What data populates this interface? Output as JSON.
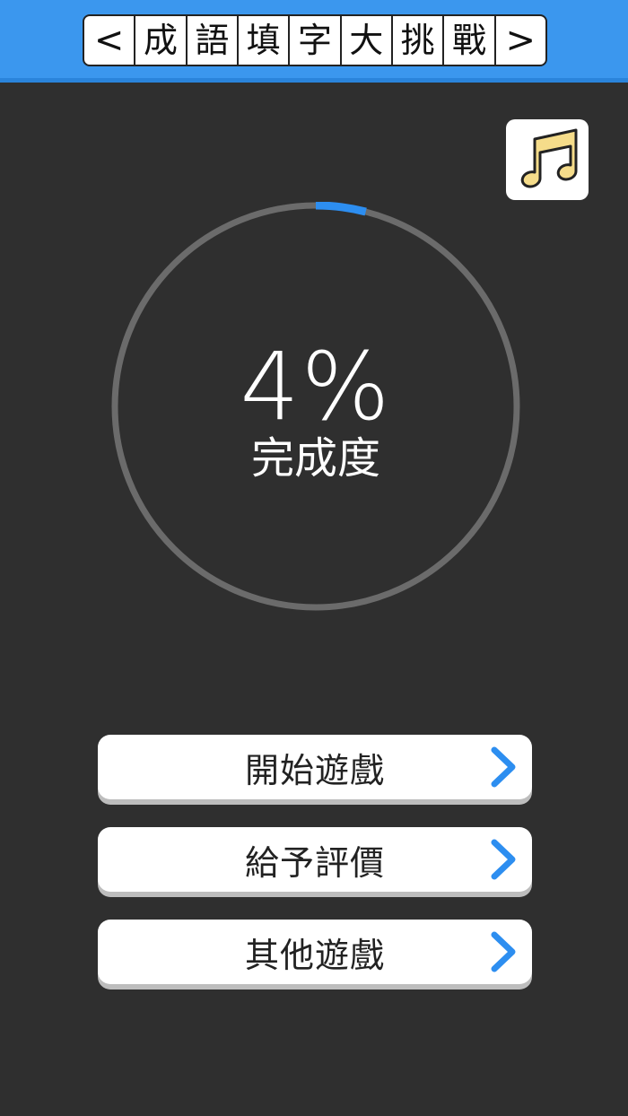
{
  "header": {
    "title_cells": [
      "<",
      "成",
      "語",
      "填",
      "字",
      "大",
      "挑",
      "戰",
      ">"
    ]
  },
  "music": {
    "icon": "music-note-icon"
  },
  "progress": {
    "value_text": "4%",
    "value": 4,
    "label": "完成度",
    "track_color": "#6b6b6b",
    "fill_color": "#2d8ef0"
  },
  "menu": {
    "start_label": "開始遊戲",
    "rate_label": "給予評價",
    "other_label": "其他遊戲",
    "chevron_color": "#2d8ef0"
  },
  "colors": {
    "header_bg": "#3b97ee",
    "page_bg": "#2f2f2f"
  }
}
